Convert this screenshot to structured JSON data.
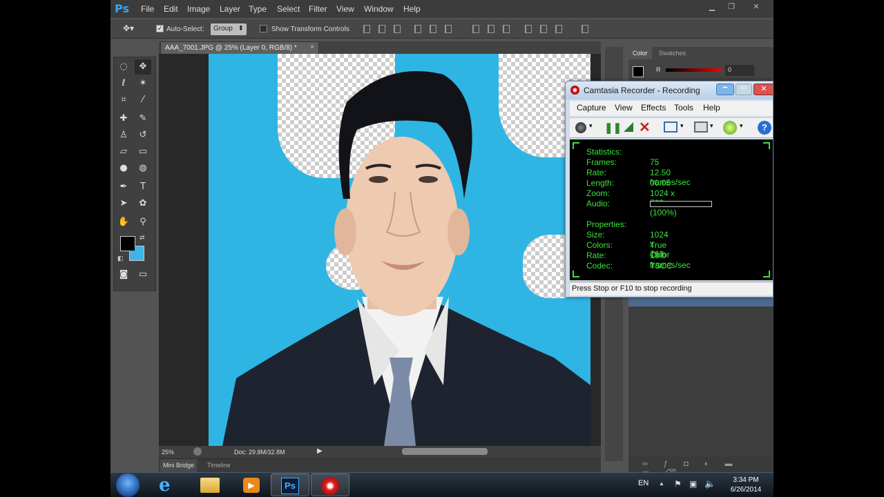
{
  "photoshop": {
    "logo": "Ps",
    "menu": [
      "File",
      "Edit",
      "Image",
      "Layer",
      "Type",
      "Select",
      "Filter",
      "View",
      "Window",
      "Help"
    ],
    "options": {
      "auto_select_label": "Auto-Select:",
      "auto_select_checked": true,
      "auto_select_target": "Group",
      "show_transform_label": "Show Transform Controls",
      "show_transform_checked": false
    },
    "document_tab": "AAA_7001.JPG @ 25% (Layer 0, RGB/8) *",
    "document_tab_close": "×",
    "status": {
      "zoom": "25%",
      "doc": "Doc: 29.8M/32.8M"
    },
    "bottom_tabs": [
      "Mini Bridge",
      "Timeline"
    ],
    "panels": {
      "color_tab": "Color",
      "swatches_tab": "Swatches",
      "r_label": "R",
      "r_value": "0"
    },
    "colors": {
      "foreground": "#000000",
      "background": "#3fb4e6"
    }
  },
  "camtasia": {
    "title": "Camtasia Recorder - Recording",
    "menu": [
      "Capture",
      "View",
      "Effects",
      "Tools",
      "Help"
    ],
    "stats_heading": "Statistics:",
    "stats": [
      {
        "label": "Frames:",
        "value": "75"
      },
      {
        "label": "Rate:",
        "value": "12.50 frames/sec"
      },
      {
        "label": "Length:",
        "value": "00:05"
      },
      {
        "label": "Zoom:",
        "value": "1024 x 768 (100%)"
      },
      {
        "label": "Audio:",
        "value": ""
      }
    ],
    "props_heading": "Properties:",
    "props": [
      {
        "label": "Size:",
        "value": "1024 x 768"
      },
      {
        "label": "Colors:",
        "value": "True Color"
      },
      {
        "label": "Rate:",
        "value": "13.0 frames/sec"
      },
      {
        "label": "Codec:",
        "value": "TSCC"
      }
    ],
    "status_text": "Press Stop or F10 to stop recording"
  },
  "taskbar": {
    "language": "EN",
    "time": "3:34 PM",
    "date": "6/26/2014",
    "ps_label": "Ps"
  }
}
